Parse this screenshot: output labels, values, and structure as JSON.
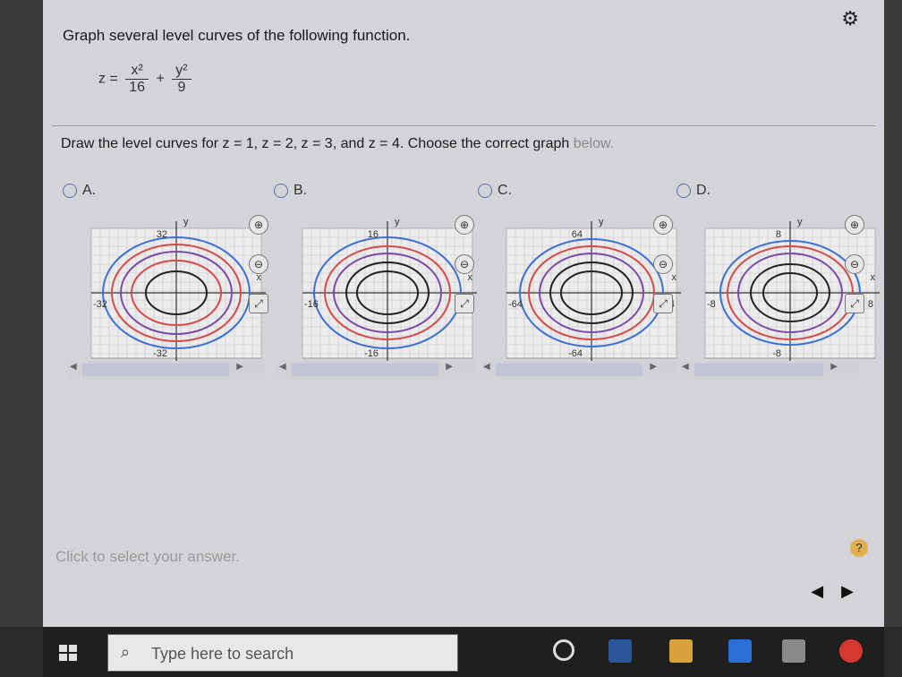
{
  "header": {
    "settings_icon": "gear-icon"
  },
  "question": {
    "title": "Graph several level curves of the following function.",
    "formula": {
      "lhs": "z =",
      "term1_num": "x²",
      "term1_den": "16",
      "plus": "+",
      "term2_num": "y²",
      "term2_den": "9"
    },
    "prompt_main": "Draw the level curves for z = 1, z = 2, z = 3, and z = 4. Choose the correct graph",
    "prompt_tail": "below."
  },
  "choices": [
    {
      "letter": "A.",
      "ymax": "32",
      "ymin": "-32",
      "xmin": "-32",
      "xmax": "32",
      "ylabel": "y",
      "xlabel": "x"
    },
    {
      "letter": "B.",
      "ymax": "16",
      "ymin": "-16",
      "xmin": "-16",
      "xmax": "16",
      "ylabel": "y",
      "xlabel": "x"
    },
    {
      "letter": "C.",
      "ymax": "64",
      "ymin": "-64",
      "xmin": "-64",
      "xmax": "64",
      "ylabel": "y",
      "xlabel": "x"
    },
    {
      "letter": "D.",
      "ymax": "8",
      "ymin": "-8",
      "xmin": "-8",
      "xmax": "8",
      "ylabel": "y",
      "xlabel": "x"
    }
  ],
  "footer": {
    "instruction": "Click to select your answer.",
    "help": "?"
  },
  "taskbar": {
    "search_placeholder": "Type here to search"
  },
  "colors": {
    "curve_blue": "#3b6fd6",
    "curve_red": "#d64a4a",
    "curve_purple": "#7a4aa8",
    "curve_black": "#222222"
  }
}
